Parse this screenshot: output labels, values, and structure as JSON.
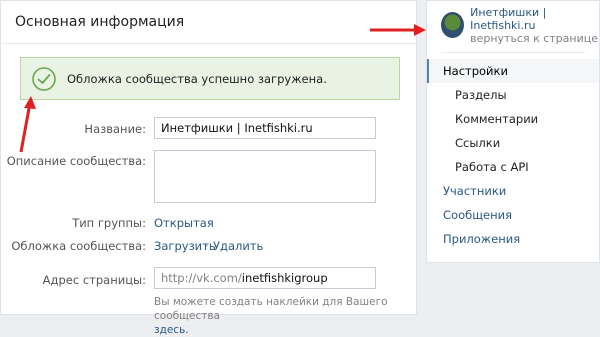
{
  "main": {
    "title": "Основная информация",
    "success_message": "Обложка сообщества успешно загружена.",
    "name_label": "Название:",
    "name_value": "Инетфишки | Inetfishki.ru",
    "description_label": "Описание сообщества:",
    "description_value": "",
    "group_type_label": "Тип группы:",
    "group_type_value": "Открытая",
    "cover_label": "Обложка сообщества:",
    "cover_upload": "Загрузить",
    "cover_separator": "·",
    "cover_delete": "Удалить",
    "address_label": "Адрес страницы:",
    "address_prefix": "http://vk.com/",
    "address_value": "inetfishkigroup",
    "hint_text": "Вы можете создать наклейки для Вашего сообщества",
    "hint_link": "здесь."
  },
  "sidebar": {
    "group_name": "Инетфишки | Inetfishki.ru",
    "back_link": "вернуться к странице",
    "items": [
      {
        "label": "Настройки"
      },
      {
        "label": "Разделы"
      },
      {
        "label": "Комментарии"
      },
      {
        "label": "Ссылки"
      },
      {
        "label": "Работа с API"
      },
      {
        "label": "Участники"
      },
      {
        "label": "Сообщения"
      },
      {
        "label": "Приложения"
      }
    ]
  },
  "colors": {
    "link": "#2a5885",
    "success_bg": "#e9f3e3",
    "success_border": "#b9d6a5",
    "annotation_arrow": "#e02020"
  },
  "icons": {
    "success": "checkmark-circle-icon",
    "avatar": "group-avatar"
  }
}
